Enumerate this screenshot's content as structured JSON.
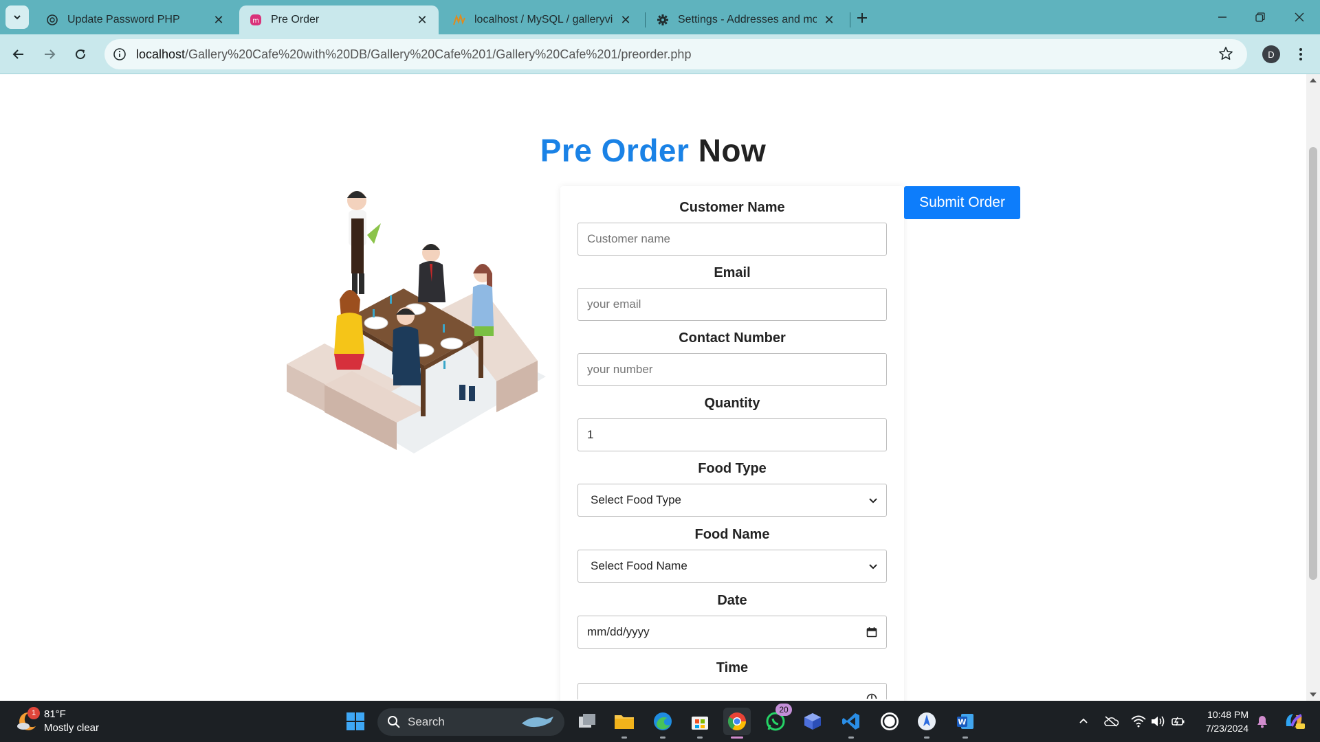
{
  "browser": {
    "tabs": [
      {
        "title": "Update Password PHP",
        "icon": "openai-icon",
        "active": false
      },
      {
        "title": "Pre Order",
        "icon": "site-icon",
        "active": true
      },
      {
        "title": "localhost / MySQL / galleryview",
        "icon": "phpmyadmin-icon",
        "active": false
      },
      {
        "title": "Settings - Addresses and more",
        "icon": "gear-icon",
        "active": false
      }
    ],
    "url_host": "localhost",
    "url_path": "/Gallery%20Cafe%20with%20DB/Gallery%20Cafe%201/Gallery%20Cafe%201/preorder.php",
    "profile_initial": "D"
  },
  "page": {
    "heading_accent": "Pre Order",
    "heading_rest": "Now",
    "submit_label": "Submit Order",
    "fields": {
      "customer_name": {
        "label": "Customer Name",
        "placeholder": "Customer name"
      },
      "email": {
        "label": "Email",
        "placeholder": "your email"
      },
      "contact": {
        "label": "Contact Number",
        "placeholder": "your number"
      },
      "quantity": {
        "label": "Quantity",
        "value": "1"
      },
      "food_type": {
        "label": "Food Type",
        "selected": "Select Food Type"
      },
      "food_name": {
        "label": "Food Name",
        "selected": "Select Food Name"
      },
      "date": {
        "label": "Date",
        "placeholder": "mm/dd/yyyy"
      },
      "time": {
        "label": "Time"
      }
    }
  },
  "taskbar": {
    "weather_temp": "81°F",
    "weather_desc": "Mostly clear",
    "weather_badge": "1",
    "search_label": "Search",
    "whatsapp_badge": "20",
    "time": "10:48 PM",
    "date": "7/23/2024"
  },
  "colors": {
    "accent": "#1a82e6",
    "button": "#0d7dfb",
    "tabbar": "#5fb3be",
    "toolbar": "#c9e8ec"
  }
}
